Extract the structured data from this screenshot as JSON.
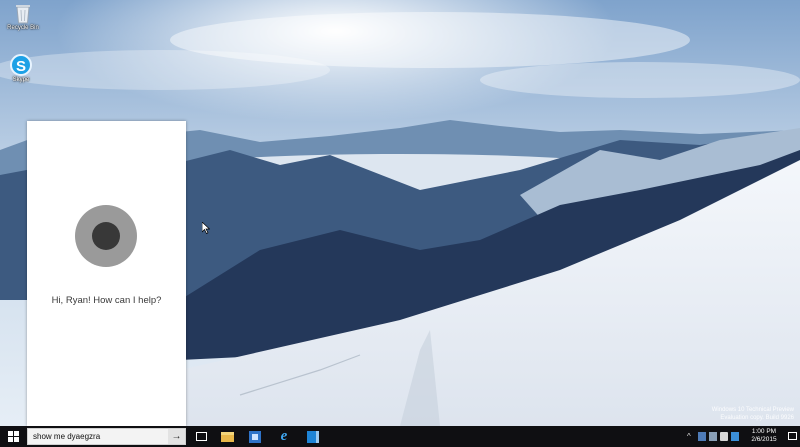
{
  "desktop": {
    "icons": [
      {
        "label": "Recycle Bin",
        "icon": "recycle-bin-icon"
      },
      {
        "label": "Skype",
        "icon": "skype-icon",
        "glyph": "S"
      }
    ],
    "watermark": {
      "line1": "Windows 10 Technical Preview",
      "line2": "Evaluation copy. Build 9926"
    }
  },
  "cortana": {
    "greeting": "Hi, Ryan! How can I help?",
    "ring_color": "#9a9a9a",
    "core_color": "#383838"
  },
  "taskbar": {
    "search": {
      "value": "show me dyaegzra",
      "go_glyph": "→"
    },
    "pinned": [
      {
        "name": "task-view",
        "icon": "task-view-icon"
      },
      {
        "name": "file-explorer",
        "icon": "folder-icon"
      },
      {
        "name": "store",
        "icon": "store-icon"
      },
      {
        "name": "internet-explorer",
        "icon": "ie-icon",
        "glyph": "e"
      },
      {
        "name": "files",
        "icon": "files-icon"
      }
    ],
    "tray": {
      "chevron": "^",
      "time": "1:00 PM",
      "date": "2/6/2015"
    }
  },
  "colors": {
    "taskbar_bg": "#0f0f12",
    "panel_bg": "#ffffff",
    "accent_blue": "#1da1e6"
  }
}
